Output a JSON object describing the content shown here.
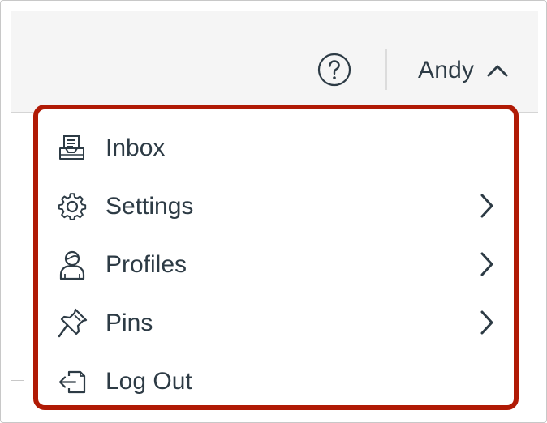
{
  "header": {
    "help_icon": "help-circle-icon",
    "user_name": "Andy",
    "user_toggle_icon": "chevron-up-icon"
  },
  "menu": {
    "highlight_color": "#b01a05",
    "items": [
      {
        "label": "Inbox",
        "icon": "inbox-icon",
        "has_submenu": false
      },
      {
        "label": "Settings",
        "icon": "gear-icon",
        "has_submenu": true
      },
      {
        "label": "Profiles",
        "icon": "user-icon",
        "has_submenu": true
      },
      {
        "label": "Pins",
        "icon": "pin-icon",
        "has_submenu": true
      },
      {
        "label": "Log Out",
        "icon": "logout-icon",
        "has_submenu": false
      }
    ]
  }
}
